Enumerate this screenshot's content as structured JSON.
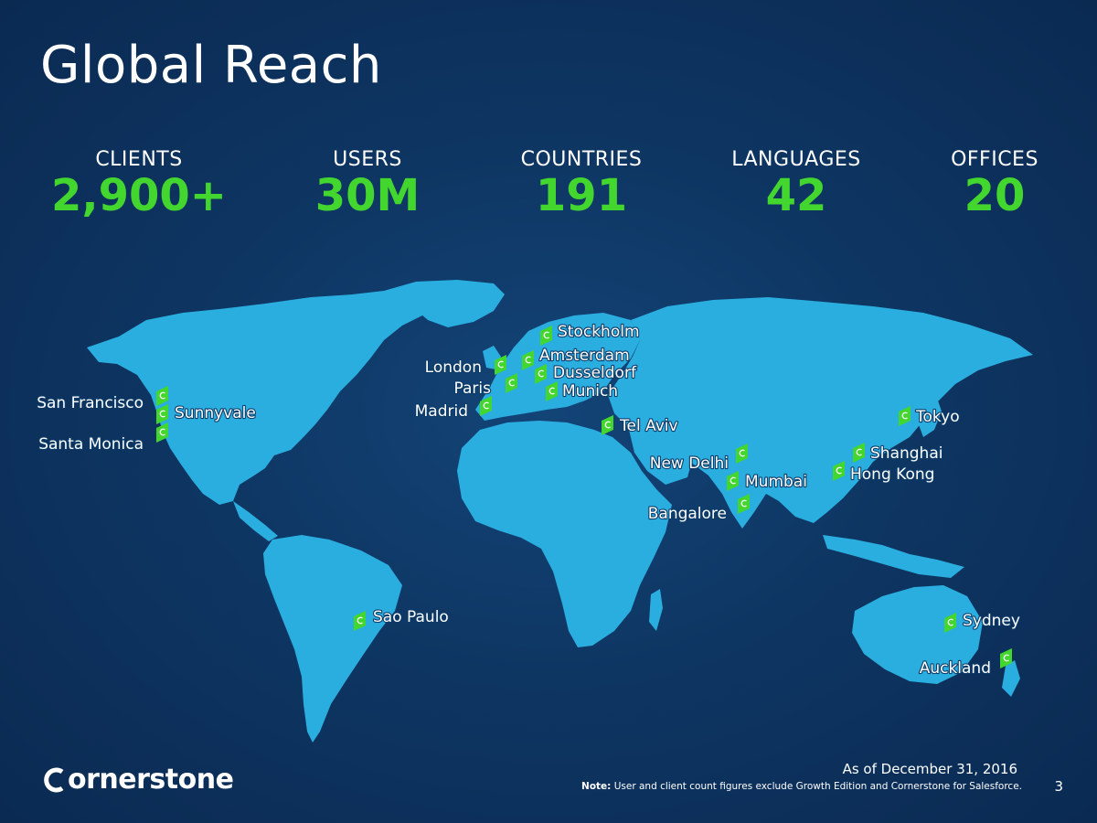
{
  "slide": {
    "title": "Global Reach",
    "page_number": "3",
    "as_of": "As of December 31, 2016",
    "note_prefix": "Note:",
    "note_text": " User and client count figures exclude Growth Edition and Cornerstone for Salesforce.",
    "logo_text": "ornerstone"
  },
  "stats": [
    {
      "label": "CLIENTS",
      "value": "2,900+"
    },
    {
      "label": "USERS",
      "value": "30M"
    },
    {
      "label": "COUNTRIES",
      "value": "191"
    },
    {
      "label": "LANGUAGES",
      "value": "42"
    },
    {
      "label": "OFFICES",
      "value": "20"
    }
  ],
  "colors": {
    "accent_green": "#43d62f",
    "land": "#2aaee0",
    "background": "#0e3663"
  },
  "offices": [
    {
      "name": "Stockholm"
    },
    {
      "name": "Amsterdam"
    },
    {
      "name": "London"
    },
    {
      "name": "Dusseldorf"
    },
    {
      "name": "Paris"
    },
    {
      "name": "Munich"
    },
    {
      "name": "Madrid"
    },
    {
      "name": "Tel Aviv"
    },
    {
      "name": "San Francisco"
    },
    {
      "name": "Sunnyvale"
    },
    {
      "name": "Santa Monica"
    },
    {
      "name": "New Delhi"
    },
    {
      "name": "Mumbai"
    },
    {
      "name": "Bangalore"
    },
    {
      "name": "Tokyo"
    },
    {
      "name": "Shanghai"
    },
    {
      "name": "Hong Kong"
    },
    {
      "name": "Sao Paulo"
    },
    {
      "name": "Sydney"
    },
    {
      "name": "Auckland"
    }
  ]
}
